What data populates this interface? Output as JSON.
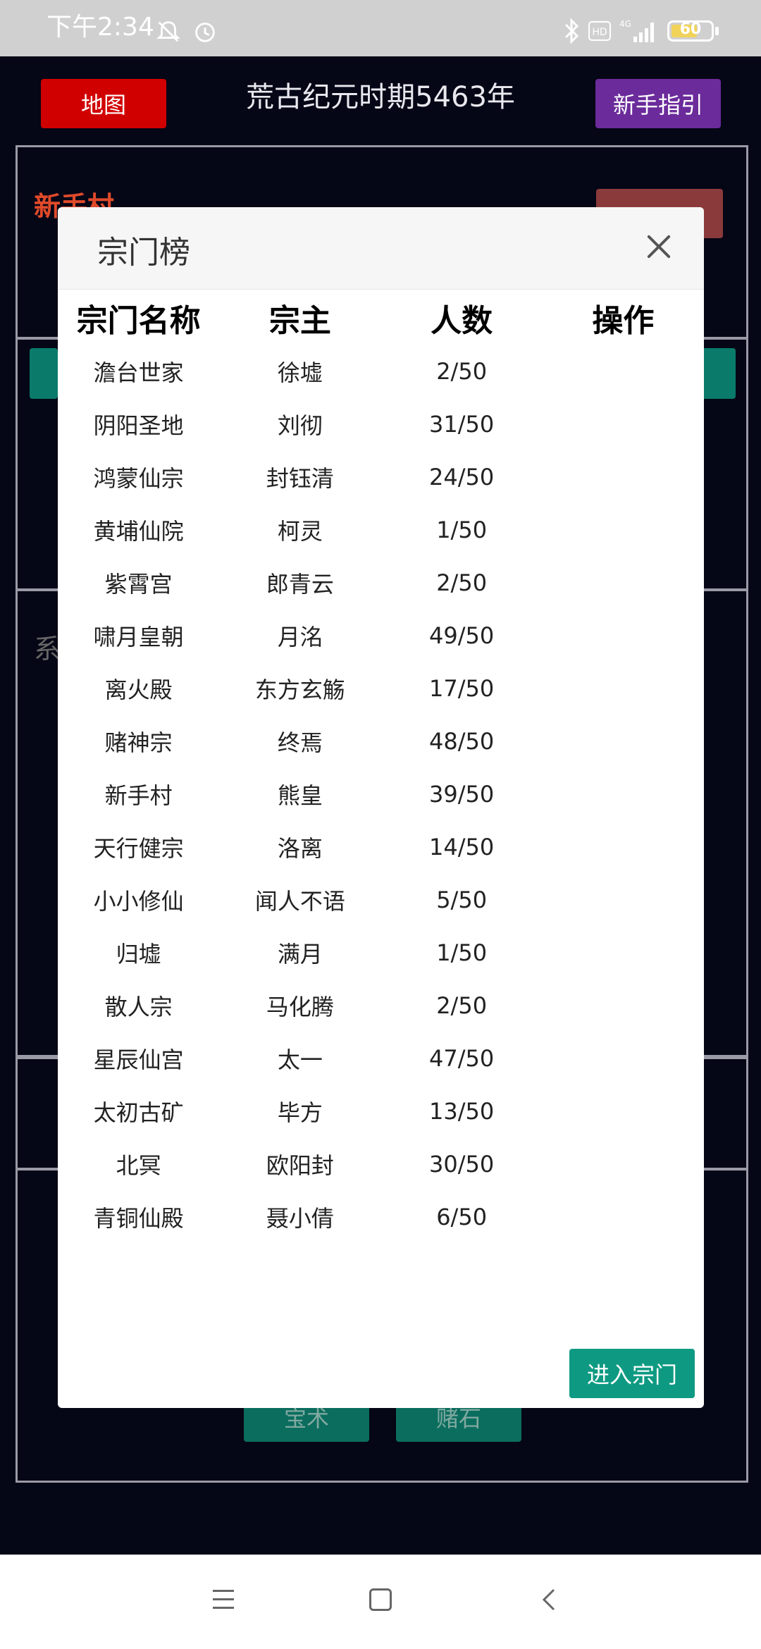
{
  "status_bar": {
    "time": "下午2:34",
    "battery": "60",
    "icons": [
      "mute-icon",
      "alarm-icon",
      "bluetooth-icon",
      "hd-icon",
      "signal-4g-icon",
      "battery-icon"
    ]
  },
  "background": {
    "map_button": "地图",
    "era_title": "荒古纪元时期5463年",
    "guide_button": "新手指引",
    "village_label": "新手村",
    "grey_char": "系",
    "bottom_button_1": "宝术",
    "bottom_button_2": "赌石"
  },
  "modal": {
    "title": "宗门榜",
    "columns": [
      "宗门名称",
      "宗主",
      "人数",
      "操作"
    ],
    "rows": [
      {
        "name": "澹台世家",
        "master": "徐墟",
        "members": "2/50"
      },
      {
        "name": "阴阳圣地",
        "master": "刘彻",
        "members": "31/50"
      },
      {
        "name": "鸿蒙仙宗",
        "master": "封钰清",
        "members": "24/50"
      },
      {
        "name": "黄埔仙院",
        "master": "柯灵",
        "members": "1/50"
      },
      {
        "name": "紫霄宫",
        "master": "郎青云",
        "members": "2/50"
      },
      {
        "name": "啸月皇朝",
        "master": "月洺",
        "members": "49/50"
      },
      {
        "name": "离火殿",
        "master": "东方玄觞",
        "members": "17/50"
      },
      {
        "name": "赌神宗",
        "master": "终焉",
        "members": "48/50"
      },
      {
        "name": "新手村",
        "master": "熊皇",
        "members": "39/50"
      },
      {
        "name": "天行健宗",
        "master": "洛离",
        "members": "14/50"
      },
      {
        "name": "小小修仙",
        "master": "闻人不语",
        "members": "5/50"
      },
      {
        "name": "归墟",
        "master": "满月",
        "members": "1/50"
      },
      {
        "name": "散人宗",
        "master": "马化腾",
        "members": "2/50"
      },
      {
        "name": "星辰仙宫",
        "master": "太一",
        "members": "47/50"
      },
      {
        "name": "太初古矿",
        "master": "毕方",
        "members": "13/50"
      },
      {
        "name": "北冥",
        "master": "欧阳封",
        "members": "30/50"
      },
      {
        "name": "青铜仙殿",
        "master": "聂小倩",
        "members": "6/50"
      }
    ],
    "enter_button": "进入宗门"
  },
  "colors": {
    "background": "#050616",
    "map_button": "#d10000",
    "guide_button": "#6b2b9b",
    "enter_button": "#0e9a82"
  }
}
